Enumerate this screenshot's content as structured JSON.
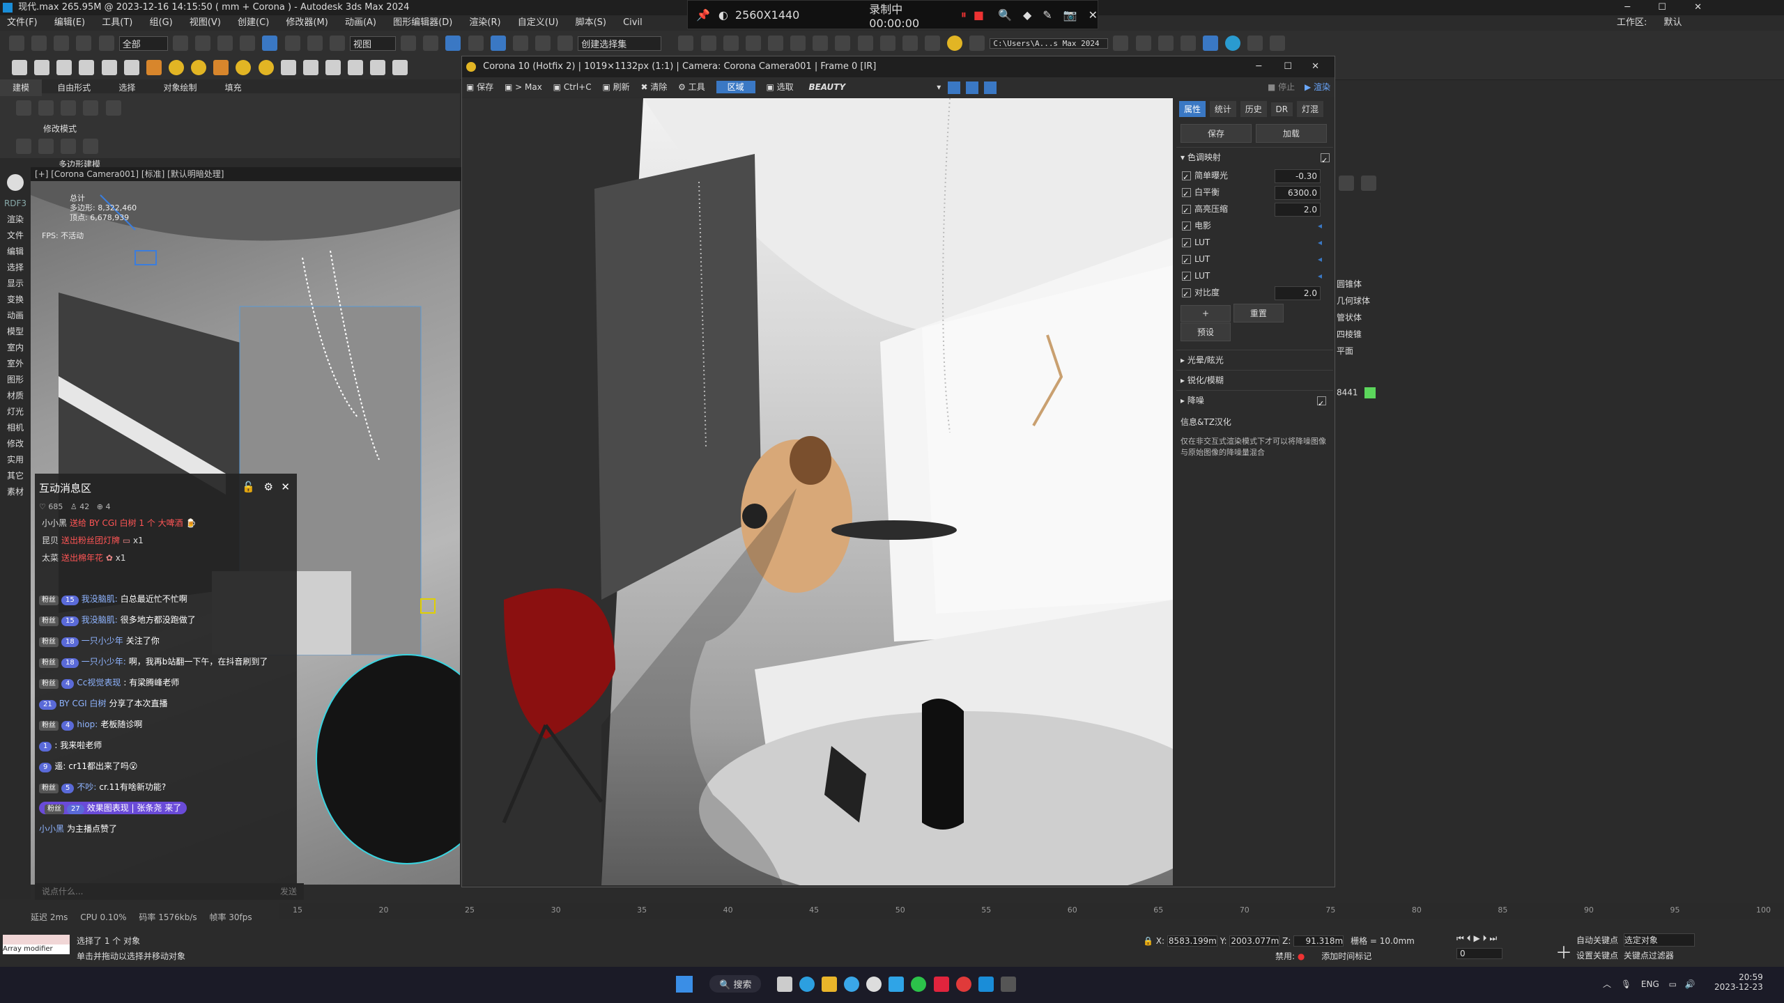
{
  "app": {
    "title": "现代.max  265.95M @ 2023-12-16 14:15:50  ( mm + Corona ) - Autodesk 3ds Max 2024",
    "workspace_label": "工作区:",
    "workspace_value": "默认"
  },
  "menu": [
    "文件(F)",
    "编辑(E)",
    "工具(T)",
    "组(G)",
    "视图(V)",
    "创建(C)",
    "修改器(M)",
    "动画(A)",
    "图形编辑器(D)",
    "渲染(R)",
    "自定义(U)",
    "脚本(S)",
    "Civil"
  ],
  "recorder": {
    "resolution": "2560X1440",
    "status": "录制中 00:00:00"
  },
  "toolbar": {
    "selection_filter": "全部",
    "view_mode": "视图",
    "named_selection": "创建选择集",
    "path": "C:\\Users\\A...s Max 2024"
  },
  "ribbon": {
    "tabs": [
      "建模",
      "自由形式",
      "选择",
      "对象绘制",
      "填充"
    ],
    "mode_label": "修改模式",
    "poly_label": "多边形建模"
  },
  "left_strip": [
    "RDF3",
    "渲染",
    "文件",
    "编辑",
    "选择",
    "显示",
    "变换",
    "动画",
    "模型",
    "室内",
    "室外",
    "图形",
    "材质",
    "灯光",
    "相机",
    "修改",
    "实用",
    "其它",
    "素材"
  ],
  "viewport": {
    "header": "[+] [Corona Camera001] [标准] [默认明暗处理]",
    "stats": [
      "总计",
      "多边形: 8,322,460",
      "顶点: 6,678,939"
    ],
    "fps": "FPS:     不活动"
  },
  "chat": {
    "title": "互动消息区",
    "likes": "685",
    "viewers": "42",
    "other": "4",
    "gifts": [
      {
        "user": "小小黑",
        "text": "送给 BY CGI 白树  1 个 大啤酒"
      },
      {
        "user": "昆贝",
        "text": "送出粉丝团灯牌",
        "count": "x1"
      },
      {
        "user": "太菜",
        "text": "送出棉年花",
        "count": "x1"
      }
    ],
    "messages": [
      {
        "tag": "粉丝",
        "level": "15",
        "user": "我没脑肌:",
        "text": "白总最近忙不忙啊"
      },
      {
        "tag": "粉丝",
        "level": "15",
        "user": "我没脑肌:",
        "text": "很多地方都没跑做了"
      },
      {
        "tag": "粉丝",
        "level": "18",
        "user": "一只小少年",
        "text": "关注了你"
      },
      {
        "tag": "粉丝",
        "level": "18",
        "user": "一只小少年:",
        "text": "啊，我再b站翻一下午，在抖音刷到了"
      },
      {
        "tag": "粉丝",
        "level": "4",
        "user": "Cc视觉表现",
        "text": ": 有梁腾峰老师"
      },
      {
        "tag": "",
        "level": "21",
        "user": "BY CGI 白树",
        "text": "分享了本次直播"
      },
      {
        "tag": "粉丝",
        "level": "4",
        "user": "hiop:",
        "text": "老板随诊啊"
      },
      {
        "tag": "",
        "level": "1",
        "user": "",
        "text": ": 我来啦老师"
      },
      {
        "tag": "",
        "level": "9",
        "user": "",
        "text": "遥: cr11都出来了吗😮"
      },
      {
        "tag": "粉丝",
        "level": "5",
        "user": "不吵:",
        "text": "cr.11有啥新功能?"
      },
      {
        "tag": "粉丝",
        "level": "27",
        "user": "效果图表现 | 张条尧",
        "text": "来了"
      },
      {
        "tag": "",
        "level": "",
        "user": "小小黑",
        "text": "为主播点赞了"
      }
    ],
    "input_placeholder": "说点什么...",
    "send_label": "发送"
  },
  "vfb": {
    "title": "Corona 10 (Hotfix 2) | 1019×1132px (1:1) | Camera: Corona Camera001 | Frame 0 [IR]",
    "toolbar": [
      "保存",
      "> Max",
      "Ctrl+C",
      "刷新",
      "清除",
      "工具",
      "区域",
      "选取"
    ],
    "channel": "BEAUTY",
    "stop_label": "停止",
    "render_label": "渲染"
  },
  "panel": {
    "tabs": [
      "属性",
      "统计",
      "历史",
      "DR",
      "灯混"
    ],
    "save_label": "保存",
    "load_label": "加载",
    "tonemap_section": "色调映射",
    "rows": [
      {
        "label": "简单曝光",
        "value": "-0.30"
      },
      {
        "label": "白平衡",
        "value": "6300.0"
      },
      {
        "label": "高亮压缩",
        "value": "2.0"
      },
      {
        "label": "电影",
        "value": ""
      },
      {
        "label": "LUT",
        "value": ""
      },
      {
        "label": "LUT",
        "value": ""
      },
      {
        "label": "LUT",
        "value": ""
      },
      {
        "label": "对比度",
        "value": "2.0"
      }
    ],
    "add_label": "+",
    "reset_label": "重置",
    "preset_label": "预设",
    "bloom_section": "光晕/眩光",
    "sharpen_section": "锐化/模糊",
    "denoise_section": "降噪",
    "info_title": "信息&TZ汉化",
    "info_text": "仅在非交互式渲染模式下才可以将降噪图像与原始图像的降噪量混合"
  },
  "cmdpanel": {
    "items": [
      "圆锥体",
      "几何球体",
      "管状体",
      "四棱锥",
      "平面"
    ],
    "color_value": "8441"
  },
  "timeline": {
    "ticks": [
      "15",
      "20",
      "25",
      "30",
      "35",
      "40",
      "45",
      "50",
      "55",
      "60",
      "65",
      "70",
      "75",
      "80",
      "85",
      "90",
      "95",
      "100"
    ]
  },
  "stats": {
    "latency": "延迟 2ms",
    "cpu": "CPU 0.10%",
    "bitrate": "码率 1576kb/s",
    "framerate": "帧率 30fps"
  },
  "status": {
    "selected": "选择了 1 个 对象",
    "hint": "单击并拖动以选择并移动对象",
    "mini_listener": "Array modifier",
    "x_value": "8583.199m",
    "y_value": "2003.077m",
    "z_value": "91.318m",
    "grid": "栅格 = 10.0mm",
    "auto_key": "自动关键点",
    "set_key": "设置关键点",
    "selected_obj": "选定对象",
    "key_filter": "关键点过滤器",
    "frame": "0",
    "disabled": "禁用:",
    "add_time_tag": "添加时间标记"
  },
  "taskbar": {
    "search": "搜索",
    "lang": "ENG",
    "time": "20:59",
    "date": "2023-12-23"
  }
}
